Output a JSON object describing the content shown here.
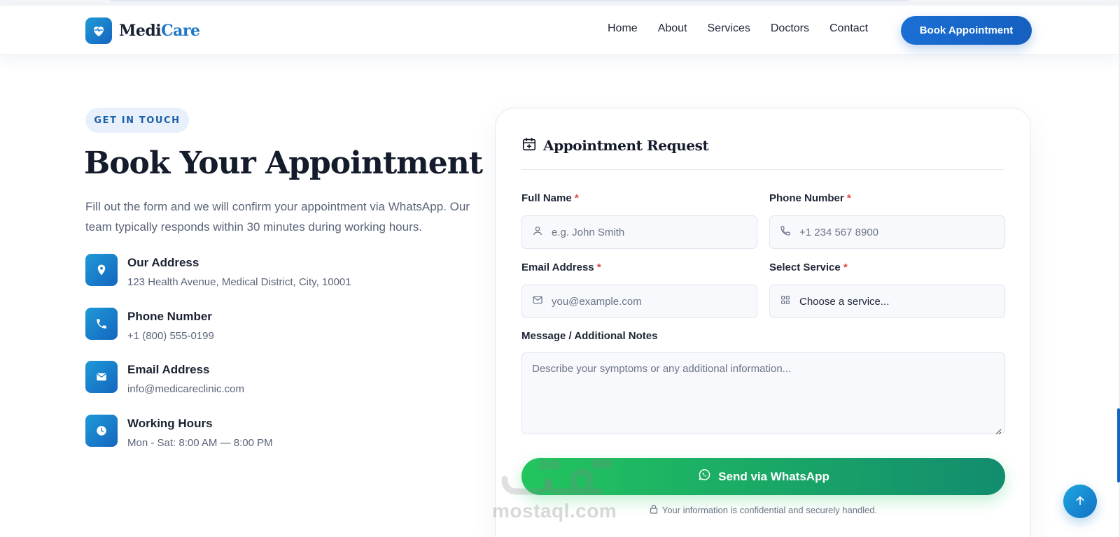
{
  "brand": {
    "name_part1": "Medi",
    "name_part2": "Care",
    "colors": {
      "primary": "#1565c0",
      "accent": "#1e9ad6",
      "whatsapp": "#22c55e"
    }
  },
  "nav": {
    "items": [
      {
        "label": "Home"
      },
      {
        "label": "About"
      },
      {
        "label": "Services"
      },
      {
        "label": "Doctors"
      },
      {
        "label": "Contact"
      }
    ],
    "cta_label": "Book Appointment"
  },
  "hero": {
    "badge": "GET IN TOUCH",
    "title": "Book Your Appointment",
    "description": "Fill out the form and we will confirm your appointment via WhatsApp. Our team typically responds within 30 minutes during working hours."
  },
  "contact_info": [
    {
      "icon": "location-pin-icon",
      "title": "Our Address",
      "text": "123 Health Avenue, Medical District, City, 10001"
    },
    {
      "icon": "phone-icon",
      "title": "Phone Number",
      "text": "+1 (800) 555-0199"
    },
    {
      "icon": "mail-icon",
      "title": "Email Address",
      "text": "info@medicareclinic.com"
    },
    {
      "icon": "clock-icon",
      "title": "Working Hours",
      "text": "Mon - Sat: 8:00 AM — 8:00 PM"
    }
  ],
  "form": {
    "title": "Appointment Request",
    "required_mark": "*",
    "full_name": {
      "label": "Full Name",
      "placeholder": "e.g. John Smith",
      "value": ""
    },
    "phone": {
      "label": "Phone Number",
      "placeholder": "+1 234 567 8900",
      "value": ""
    },
    "email": {
      "label": "Email Address",
      "placeholder": "you@example.com",
      "value": ""
    },
    "service": {
      "label": "Select Service",
      "selected": "Choose a service..."
    },
    "message": {
      "label": "Message / Additional Notes",
      "placeholder": "Describe your symptoms or any additional information...",
      "value": ""
    },
    "submit_label": "Send via WhatsApp",
    "secure_note": "Your information is confidential and securely handled."
  },
  "watermark": {
    "text": "mostaql.com"
  }
}
